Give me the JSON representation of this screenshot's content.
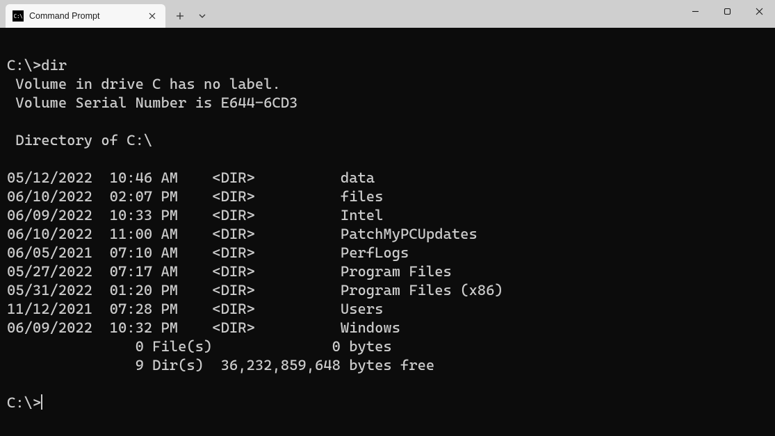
{
  "window": {
    "tab_title": "Command Prompt",
    "tab_icon_text": "C:\\"
  },
  "terminal": {
    "prompt1": "C:\\>",
    "command": "dir",
    "volume_line": " Volume in drive C has no label.",
    "serial_line": " Volume Serial Number is E644-6CD3",
    "directory_line": " Directory of C:\\",
    "entries": [
      {
        "date": "05/12/2022",
        "time": "10:46 AM",
        "type": "<DIR>",
        "name": "data"
      },
      {
        "date": "06/10/2022",
        "time": "02:07 PM",
        "type": "<DIR>",
        "name": "files"
      },
      {
        "date": "06/09/2022",
        "time": "10:33 PM",
        "type": "<DIR>",
        "name": "Intel"
      },
      {
        "date": "06/10/2022",
        "time": "11:00 AM",
        "type": "<DIR>",
        "name": "PatchMyPCUpdates"
      },
      {
        "date": "06/05/2021",
        "time": "07:10 AM",
        "type": "<DIR>",
        "name": "PerfLogs"
      },
      {
        "date": "05/27/2022",
        "time": "07:17 AM",
        "type": "<DIR>",
        "name": "Program Files"
      },
      {
        "date": "05/31/2022",
        "time": "01:20 PM",
        "type": "<DIR>",
        "name": "Program Files (x86)"
      },
      {
        "date": "11/12/2021",
        "time": "07:28 PM",
        "type": "<DIR>",
        "name": "Users"
      },
      {
        "date": "06/09/2022",
        "time": "10:32 PM",
        "type": "<DIR>",
        "name": "Windows"
      }
    ],
    "summary_files": "               0 File(s)              0 bytes",
    "summary_dirs": "               9 Dir(s)  36,232,859,648 bytes free",
    "prompt2": "C:\\>"
  }
}
